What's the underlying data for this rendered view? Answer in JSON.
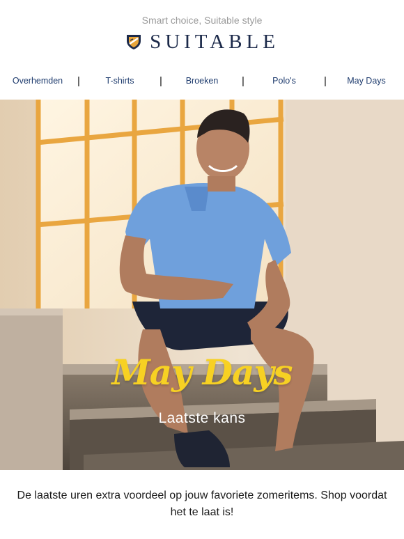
{
  "header": {
    "tagline": "Smart choice, Suitable style",
    "brand": "SUITABLE",
    "logo_icon": "crest-icon"
  },
  "nav": {
    "items": [
      {
        "label": "Overhemden"
      },
      {
        "label": "T-shirts"
      },
      {
        "label": "Broeken"
      },
      {
        "label": "Polo's"
      },
      {
        "label": "May Days"
      }
    ],
    "separator": "|"
  },
  "hero": {
    "title": "May Days",
    "subtitle": "Laatste kans",
    "title_color": "#f7d123"
  },
  "body": {
    "text": "De laatste uren extra voordeel op jouw favoriete zomeritems. Shop voordat het te laat is!"
  }
}
